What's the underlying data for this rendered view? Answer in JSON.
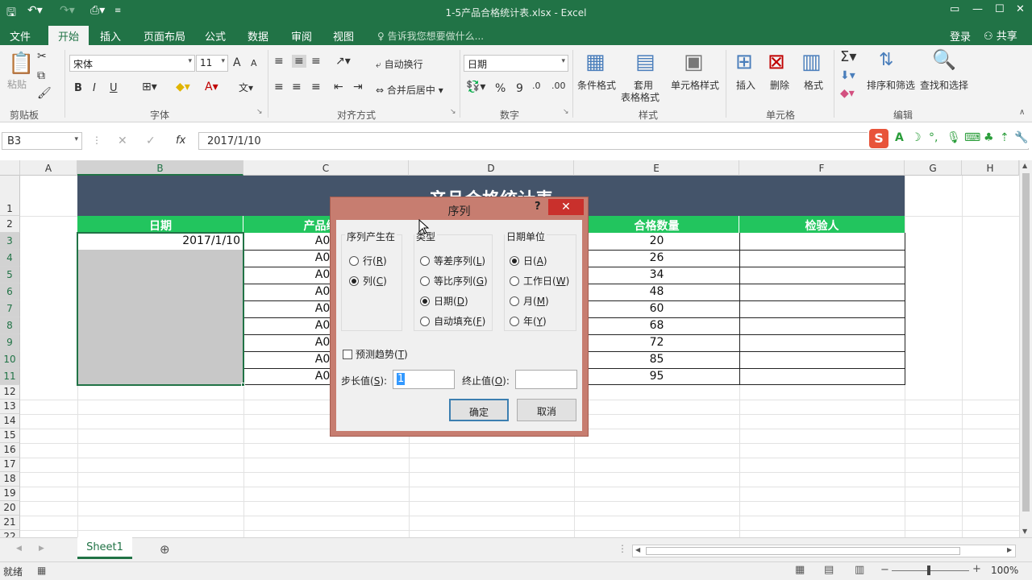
{
  "window": {
    "title": "1-5产品合格统计表.xlsx - Excel"
  },
  "ribbon_tabs": [
    "文件",
    "开始",
    "插入",
    "页面布局",
    "公式",
    "数据",
    "审阅",
    "视图"
  ],
  "tell_me": "告诉我您想要做什么...",
  "login": "登录",
  "share": "共享",
  "clipboard": {
    "paste": "粘贴",
    "label": "剪贴板"
  },
  "font": {
    "name": "宋体",
    "size": "11",
    "bold": "B",
    "italic": "I",
    "underline": "U",
    "label": "字体",
    "grow": "A",
    "shrink": "A"
  },
  "alignment": {
    "wrap": "自动换行",
    "merge": "合并后居中",
    "label": "对齐方式"
  },
  "number": {
    "format": "日期",
    "percent": "%",
    "comma": "9",
    "label": "数字"
  },
  "styles": {
    "conditional": "条件格式",
    "table_l1": "套用",
    "table_l2": "表格格式",
    "cell_styles": "单元格样式",
    "label": "样式"
  },
  "cells": {
    "insert": "插入",
    "delete": "删除",
    "format": "格式",
    "label": "单元格"
  },
  "editing": {
    "sort": "排序和筛选",
    "find": "查找和选择",
    "label": "编辑"
  },
  "formula_bar": {
    "name_box": "B3",
    "fx": "fx",
    "cancel": "✕",
    "enter": "✓",
    "content": "2017/1/10"
  },
  "sheet": {
    "columns": [
      "A",
      "B",
      "C",
      "D",
      "E",
      "F",
      "G",
      "H"
    ],
    "rows": [
      "1",
      "2",
      "3",
      "4",
      "5",
      "6",
      "7",
      "8",
      "9",
      "10",
      "11",
      "12",
      "13",
      "14",
      "15",
      "16",
      "17",
      "18",
      "19",
      "20",
      "21",
      "22"
    ],
    "title": "产品合格统计表",
    "headers": [
      "日期",
      "产品编号",
      "",
      "合格数量",
      "检验人"
    ],
    "dates": [
      "2017/1/10",
      "",
      "",
      "",
      "",
      "",
      "",
      "",
      ""
    ],
    "product_codes": [
      "A00",
      "A00",
      "A00",
      "A00",
      "A00",
      "A00",
      "A00",
      "A00",
      "A00"
    ],
    "qualified_qty": [
      "20",
      "26",
      "34",
      "48",
      "60",
      "68",
      "72",
      "85",
      "95"
    ]
  },
  "sheet_tabs": [
    "Sheet1"
  ],
  "status": {
    "ready": "就绪",
    "zoom": "100%"
  },
  "dialog": {
    "title": "序列",
    "help": "?",
    "close": "✕",
    "series_in": {
      "legend": "序列产生在",
      "options": [
        {
          "label": "行(",
          "key": "R",
          "tail": ")",
          "checked": false
        },
        {
          "label": "列(",
          "key": "C",
          "tail": ")",
          "checked": true
        }
      ]
    },
    "type": {
      "legend": "类型",
      "options": [
        {
          "label": "等差序列(",
          "key": "L",
          "tail": ")",
          "checked": false
        },
        {
          "label": "等比序列(",
          "key": "G",
          "tail": ")",
          "checked": false
        },
        {
          "label": "日期(",
          "key": "D",
          "tail": ")",
          "checked": true
        },
        {
          "label": "自动填充(",
          "key": "F",
          "tail": ")",
          "checked": false
        }
      ]
    },
    "date_unit": {
      "legend": "日期单位",
      "options": [
        {
          "label": "日(",
          "key": "A",
          "tail": ")",
          "checked": true
        },
        {
          "label": "工作日(",
          "key": "W",
          "tail": ")",
          "checked": false
        },
        {
          "label": "月(",
          "key": "M",
          "tail": ")",
          "checked": false
        },
        {
          "label": "年(",
          "key": "Y",
          "tail": ")",
          "checked": false
        }
      ]
    },
    "trend": {
      "label": "预测趋势(",
      "key": "T",
      "tail": ")"
    },
    "step": {
      "label": "步长值(",
      "key": "S",
      "tail": "):",
      "value": "1"
    },
    "stop": {
      "label": "终止值(",
      "key": "O",
      "tail": "):",
      "value": ""
    },
    "ok": "确定",
    "cancel": "取消"
  },
  "colors": {
    "excel_green": "#217346",
    "title_fill": "#44546a",
    "header_fill": "#22c55e",
    "selected_fill": "#c8c8c8",
    "dialog_frame": "#c77d70"
  }
}
